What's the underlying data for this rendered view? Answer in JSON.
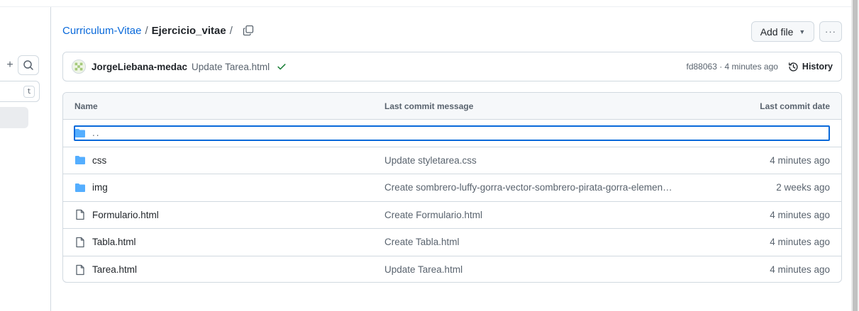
{
  "sidebar": {
    "plus_glyph": "+",
    "search_icon": "search-icon",
    "filter_shortcut": "t"
  },
  "breadcrumb": {
    "repo": "Curriculum-Vitae",
    "separator": "/",
    "folder": "Ejercicio_vitae",
    "trailing_separator": "/"
  },
  "actions": {
    "add_file_label": "Add file",
    "more_label": "···"
  },
  "latest_commit": {
    "author": "JorgeLiebana-medac",
    "message": "Update Tarea.html",
    "status": "success",
    "meta": "fd88063 · 4 minutes ago",
    "history_label": "History"
  },
  "table": {
    "headers": {
      "name": "Name",
      "message": "Last commit message",
      "date": "Last commit date"
    },
    "parent_label": "..",
    "rows": [
      {
        "type": "dir",
        "name": "css",
        "message": "Update styletarea.css",
        "date": "4 minutes ago"
      },
      {
        "type": "dir",
        "name": "img",
        "message": "Create sombrero-luffy-gorra-vector-sombrero-pirata-gorra-elemento-sit…",
        "date": "2 weeks ago"
      },
      {
        "type": "file",
        "name": "Formulario.html",
        "message": "Create Formulario.html",
        "date": "4 minutes ago"
      },
      {
        "type": "file",
        "name": "Tabla.html",
        "message": "Create Tabla.html",
        "date": "4 minutes ago"
      },
      {
        "type": "file",
        "name": "Tarea.html",
        "message": "Update Tarea.html",
        "date": "4 minutes ago"
      }
    ]
  },
  "colors": {
    "link": "#0969da",
    "folder": "#54aeff",
    "success": "#1a7f37",
    "border": "#d1d9e0",
    "muted": "#59636e"
  }
}
